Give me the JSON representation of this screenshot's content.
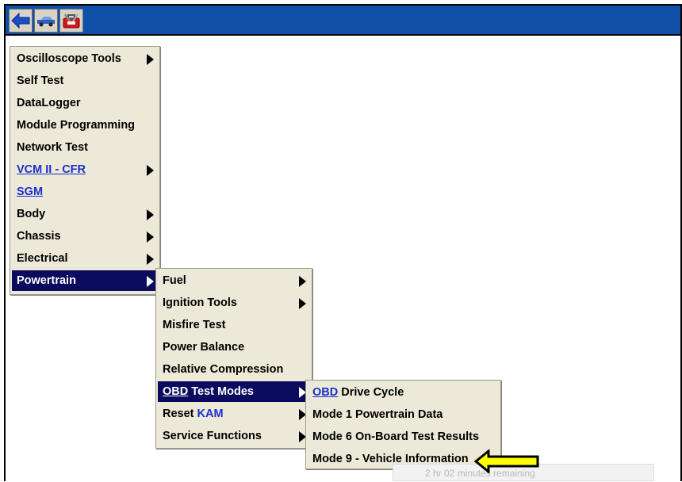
{
  "toolbar": {
    "buttons": [
      {
        "name": "back-arrow-icon"
      },
      {
        "name": "vehicle-icon"
      },
      {
        "name": "toolbox-icon"
      }
    ]
  },
  "main_menu": {
    "items": [
      {
        "label": "Oscilloscope Tools",
        "submenu": true
      },
      {
        "label": "Self Test",
        "submenu": false
      },
      {
        "label": "DataLogger",
        "submenu": false
      },
      {
        "label": "Module Programming",
        "submenu": false
      },
      {
        "label": "Network Test",
        "submenu": false
      },
      {
        "label": "VCM II - CFR",
        "submenu": true,
        "link": true
      },
      {
        "label": "SGM",
        "submenu": false,
        "link": true
      },
      {
        "label": "Body",
        "submenu": true
      },
      {
        "label": "Chassis",
        "submenu": true
      },
      {
        "label": "Electrical",
        "submenu": true
      },
      {
        "label": "Powertrain",
        "submenu": true,
        "selected": true
      }
    ]
  },
  "powertrain_menu": {
    "items": [
      {
        "label": "Fuel",
        "submenu": true
      },
      {
        "label": "Ignition Tools",
        "submenu": true
      },
      {
        "label": "Misfire Test",
        "submenu": false
      },
      {
        "label": "Power Balance",
        "submenu": false
      },
      {
        "label": "Relative Compression",
        "submenu": false
      },
      {
        "label_prefix": "OBD",
        "label_rest": " Test Modes",
        "submenu": true,
        "selected": true
      },
      {
        "label_prefix": "Reset ",
        "label_rest": "KAM",
        "submenu": true
      },
      {
        "label": "Service Functions",
        "submenu": true
      }
    ]
  },
  "obd_menu": {
    "items": [
      {
        "label_prefix": "OBD",
        "label_rest": " Drive Cycle"
      },
      {
        "label": "Mode 1 Powertrain Data"
      },
      {
        "label": "Mode 6 On-Board Test Results"
      },
      {
        "label": "Mode 9 - Vehicle Information"
      }
    ]
  },
  "background_notice": {
    "text": "2 hr 02 minutes remaining"
  },
  "colors": {
    "titlebar": "#1050a8",
    "menu_bg": "#ece9d8",
    "selected_bg": "#0a0a5e",
    "link": "#1a2fcc",
    "pointer_fill": "#ffff00"
  }
}
